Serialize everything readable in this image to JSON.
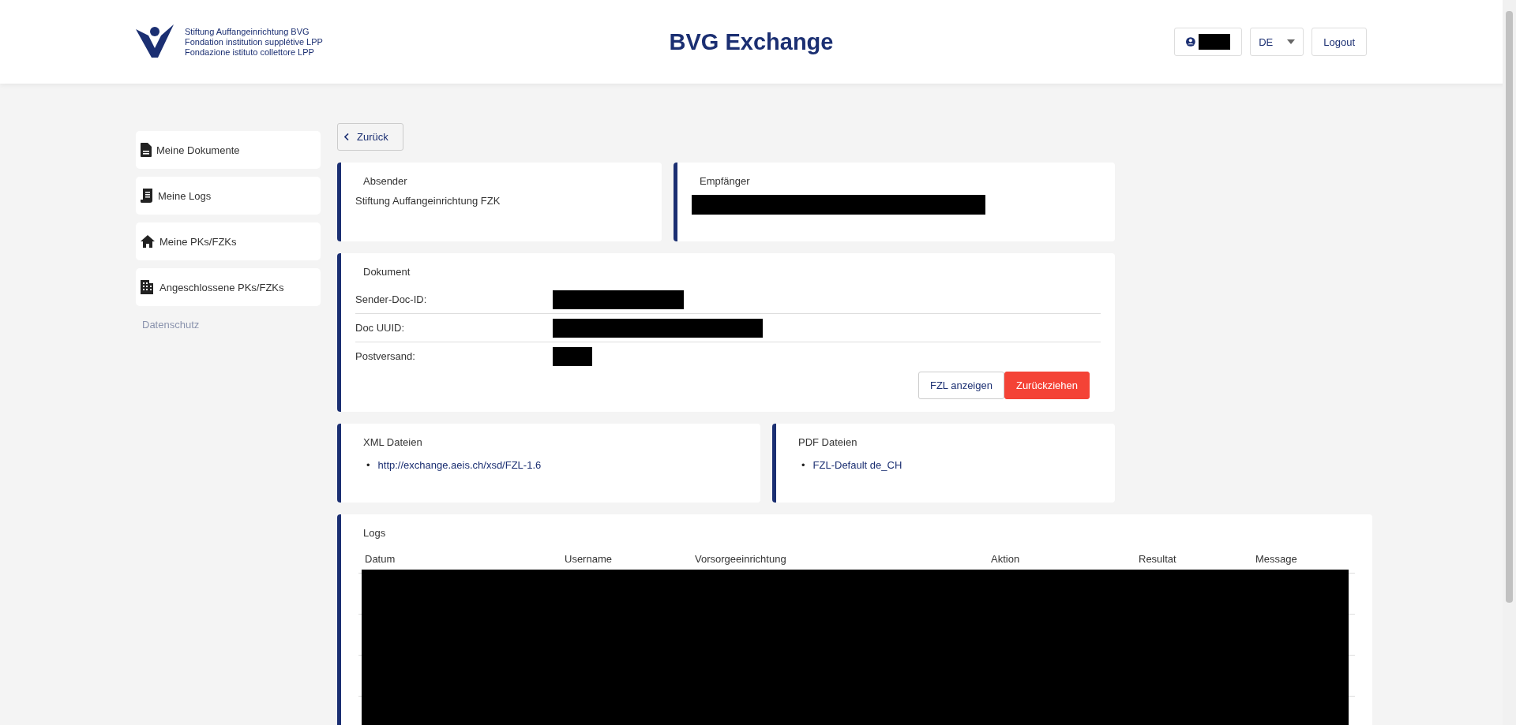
{
  "header": {
    "logo_lines": [
      "Stiftung Auffangeinrichtung BVG",
      "Fondation institution supplétive LPP",
      "Fondazione istituto collettore LPP"
    ],
    "title": "BVG Exchange",
    "language": "DE",
    "logout": "Logout"
  },
  "sidebar": {
    "items": [
      {
        "label": "Meine Dokumente"
      },
      {
        "label": "Meine Logs"
      },
      {
        "label": "Meine PKs/FZKs"
      },
      {
        "label": "Angeschlossene PKs/FZKs"
      }
    ],
    "footer_link": "Datenschutz"
  },
  "back_button": "Zurück",
  "sender": {
    "title": "Absender",
    "value": "Stiftung Auffangeinrichtung FZK"
  },
  "recipient": {
    "title": "Empfänger"
  },
  "document": {
    "title": "Dokument",
    "fields": [
      {
        "label": "Sender-Doc-ID:"
      },
      {
        "label": "Doc UUID:"
      },
      {
        "label": "Postversand:"
      }
    ],
    "buttons": [
      {
        "label": "FZL anzeigen",
        "kind": "secondary"
      },
      {
        "label": "Zurückziehen",
        "kind": "danger"
      }
    ]
  },
  "xml_files": {
    "title": "XML Dateien",
    "items": [
      {
        "marker": "•",
        "text": "http://exchange.aeis.ch/xsd/FZL-1.6"
      }
    ]
  },
  "pdf_files": {
    "title": "PDF Dateien",
    "items": [
      {
        "marker": "•",
        "text": "FZL-Default de_CH"
      }
    ]
  },
  "logs": {
    "title": "Logs",
    "columns": [
      "Datum",
      "Username",
      "Vorsorgeeinrichtung",
      "Aktion",
      "Resultat",
      "Message"
    ]
  }
}
